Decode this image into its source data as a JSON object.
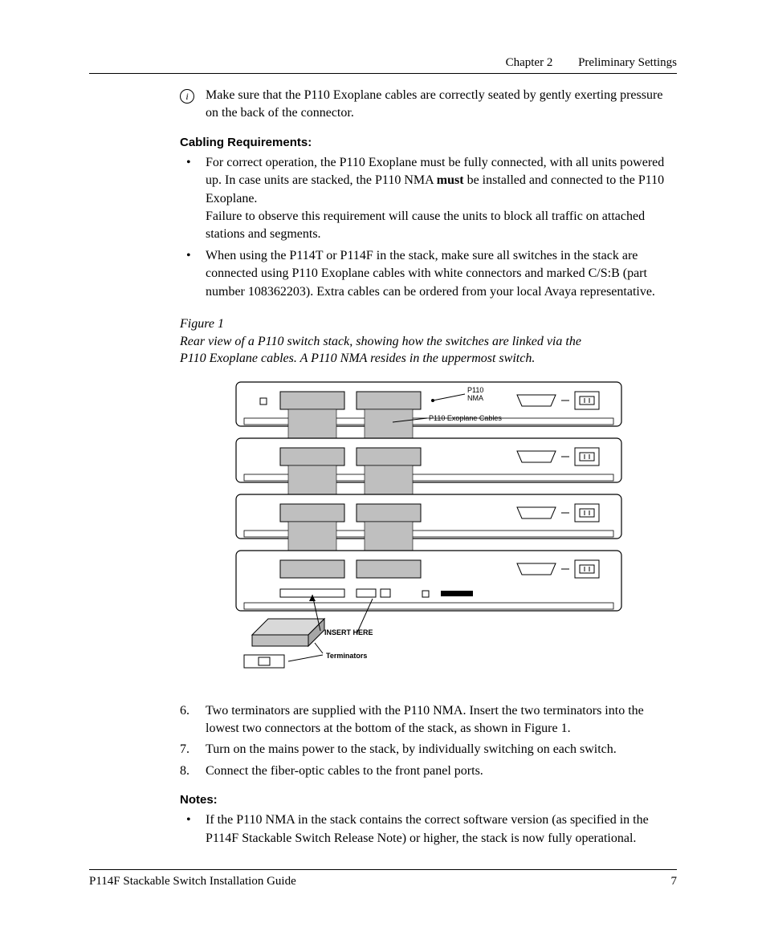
{
  "header": {
    "chapter": "Chapter 2",
    "title": "Preliminary Settings"
  },
  "info_note": "Make sure that the P110 Exoplane cables are correctly seated by gently exerting pressure on the back of the connector.",
  "cabling_heading": "Cabling Requirements:",
  "cabling_bullets": [
    {
      "text_before": "For correct operation, the P110 Exoplane must be fully connected, with all units powered up. In case units are stacked, the P110 NMA ",
      "bold": "must",
      "text_after": " be installed and connected to the P110 Exoplane.\nFailure to observe this requirement will cause the units to block all traffic on attached stations and segments."
    },
    {
      "text_before": "When using the P114T or P114F in the stack, make sure all switches in the stack are connected using P110 Exoplane cables with white connectors and marked C/S:B (part number 108362203). Extra cables can be ordered from your local Avaya representative.",
      "bold": "",
      "text_after": ""
    }
  ],
  "figure": {
    "label": "Figure 1",
    "caption": "Rear view of a P110 switch stack, showing how the switches are linked via the P110 Exoplane cables. A P110 NMA resides in the uppermost switch.",
    "labels": {
      "nma": "P110\nNMA",
      "cables": "P110 Exoplane Cables",
      "insert": "INSERT HERE",
      "terminators": "Terminators"
    }
  },
  "steps": [
    {
      "n": "6.",
      "t": "Two terminators are supplied with the P110 NMA. Insert the two terminators into the lowest two connectors at the bottom of the stack, as shown in Figure 1."
    },
    {
      "n": "7.",
      "t": "Turn on the mains power to the stack, by individually switching on each switch."
    },
    {
      "n": "8.",
      "t": "Connect the fiber-optic cables to the front panel ports."
    }
  ],
  "notes_heading": "Notes:",
  "notes_bullets": [
    "If the P110 NMA in the stack contains the correct software version (as specified in the P114F Stackable Switch Release Note) or higher, the stack is now fully operational."
  ],
  "footer": {
    "doc": "P114F Stackable Switch Installation Guide",
    "page": "7"
  }
}
